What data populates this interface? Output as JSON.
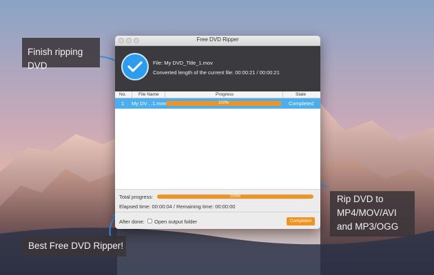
{
  "colors": {
    "accent_orange": "#f0941f",
    "selection_blue": "#4aaef0",
    "header_dark": "#3b3b3f",
    "callout_bg": "#3a3438"
  },
  "callouts": {
    "top_left": "Finish ripping DVD",
    "right_lines": [
      "Rip DVD to",
      "MP4/MOV/AVI",
      "and MP3/OGG"
    ],
    "bottom_left": "Best Free DVD Ripper!"
  },
  "window": {
    "title": "Free DVD Ripper",
    "status_icon": "checkmark-icon",
    "file_label": "File: My DVD_Title_1.mov",
    "converted_label": "Converted length of the current file: 00:00:21 / 00:00:21"
  },
  "table": {
    "columns": [
      "No.",
      "File Name",
      "Progress",
      "State"
    ],
    "rows": [
      {
        "no": "1",
        "file_name": "My DV…1.mov",
        "progress": 1.0,
        "progress_text": "100%",
        "state": "Completed"
      }
    ]
  },
  "footer": {
    "total_progress_label": "Total progress:",
    "total_progress": 1.0,
    "total_progress_text": "100%",
    "elapsed_text": "Elapsed time: 00:00:04 / Remaining time: 00:00:00",
    "after_done_label": "After done:",
    "open_output_label": "Open output folder",
    "open_output_checked": false,
    "status_button": "Completed"
  }
}
